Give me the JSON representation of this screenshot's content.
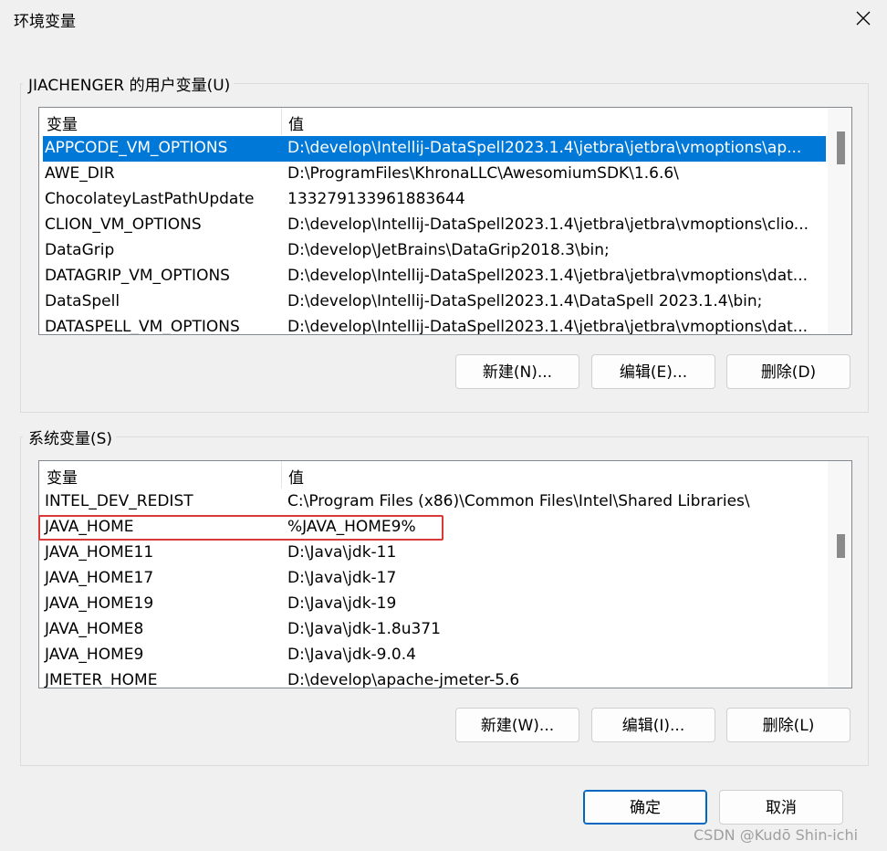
{
  "window": {
    "title": "环境变量",
    "close_icon": "close-icon"
  },
  "user_vars": {
    "legend": "JIACHENGER 的用户变量(U)",
    "headers": {
      "name": "变量",
      "value": "值"
    },
    "rows": [
      {
        "name": "APPCODE_VM_OPTIONS",
        "value": "D:\\develop\\Intellij-DataSpell2023.1.4\\jetbra\\jetbra\\vmoptions\\ap...",
        "selected": true
      },
      {
        "name": "AWE_DIR",
        "value": "D:\\ProgramFiles\\KhronaLLC\\AwesomiumSDK\\1.6.6\\"
      },
      {
        "name": "ChocolateyLastPathUpdate",
        "value": "133279133961883644"
      },
      {
        "name": "CLION_VM_OPTIONS",
        "value": "D:\\develop\\Intellij-DataSpell2023.1.4\\jetbra\\jetbra\\vmoptions\\clio..."
      },
      {
        "name": "DataGrip",
        "value": "D:\\develop\\JetBrains\\DataGrip2018.3\\bin;"
      },
      {
        "name": "DATAGRIP_VM_OPTIONS",
        "value": "D:\\develop\\Intellij-DataSpell2023.1.4\\jetbra\\jetbra\\vmoptions\\dat..."
      },
      {
        "name": "DataSpell",
        "value": "D:\\develop\\Intellij-DataSpell2023.1.4\\DataSpell 2023.1.4\\bin;"
      },
      {
        "name": "DATASPELL_VM_OPTIONS",
        "value": "D:\\develop\\Intellij-DataSpell2023.1.4\\jetbra\\jetbra\\vmoptions\\dat..."
      }
    ],
    "buttons": {
      "new": "新建(N)...",
      "edit": "编辑(E)...",
      "delete": "删除(D)"
    }
  },
  "system_vars": {
    "legend": "系统变量(S)",
    "headers": {
      "name": "变量",
      "value": "值"
    },
    "rows": [
      {
        "name": "INTEL_DEV_REDIST",
        "value": "C:\\Program Files (x86)\\Common Files\\Intel\\Shared Libraries\\"
      },
      {
        "name": "JAVA_HOME",
        "value": "%JAVA_HOME9%",
        "highlighted": true
      },
      {
        "name": "JAVA_HOME11",
        "value": "D:\\Java\\jdk-11"
      },
      {
        "name": "JAVA_HOME17",
        "value": "D:\\Java\\jdk-17"
      },
      {
        "name": "JAVA_HOME19",
        "value": "D:\\Java\\jdk-19"
      },
      {
        "name": "JAVA_HOME8",
        "value": "D:\\Java\\jdk-1.8u371"
      },
      {
        "name": "JAVA_HOME9",
        "value": "D:\\Java\\jdk-9.0.4"
      },
      {
        "name": "JMETER_HOME",
        "value": "D:\\develop\\apache-jmeter-5.6"
      }
    ],
    "buttons": {
      "new": "新建(W)...",
      "edit": "编辑(I)...",
      "delete": "删除(L)"
    }
  },
  "footer": {
    "ok": "确定",
    "cancel": "取消"
  },
  "watermark": "CSDN @Kudō Shin-ichi",
  "colors": {
    "selection": "#0078d7",
    "highlight_box": "#d83a3a",
    "primary_border": "#0067c0"
  }
}
